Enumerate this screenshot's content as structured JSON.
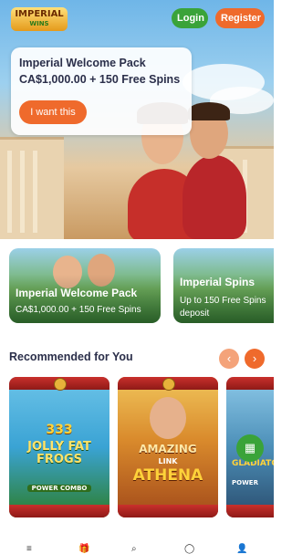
{
  "header": {
    "logo_text": "IMPERIAL",
    "logo_sub": "WINS",
    "login_label": "Login",
    "register_label": "Register"
  },
  "promo": {
    "title": "Imperial Welcome Pack",
    "subtitle": "CA$1,000.00 + 150 Free Spins",
    "cta": "I want this"
  },
  "offers": [
    {
      "title": "Imperial Welcome Pack",
      "subtitle": "CA$1,000.00 + 150 Free Spins"
    },
    {
      "title": "Imperial Spins",
      "subtitle": "Up to 150 Free Spins",
      "subtitle2": "deposit"
    }
  ],
  "recommended": {
    "heading": "Recommended for You",
    "prev_icon": "‹",
    "next_icon": "›"
  },
  "games": [
    {
      "title_top": "333",
      "title_main": "JOLLY FAT FROGS",
      "badge": "POWER COMBO"
    },
    {
      "title_top": "AMAZING",
      "title_mid": "LINK",
      "title_main": "ATHENA"
    },
    {
      "title_main": "GLADIATOR",
      "badge": "POWER"
    }
  ],
  "colors": {
    "accent_orange": "#ef6a2c",
    "accent_green": "#3aa339",
    "text_dark": "#2b2f4a"
  },
  "nav": {
    "menu_icon": "≡",
    "gift_icon": "🎁",
    "search_icon": "⌕",
    "chat_icon": "◯",
    "user_icon": "👤"
  }
}
